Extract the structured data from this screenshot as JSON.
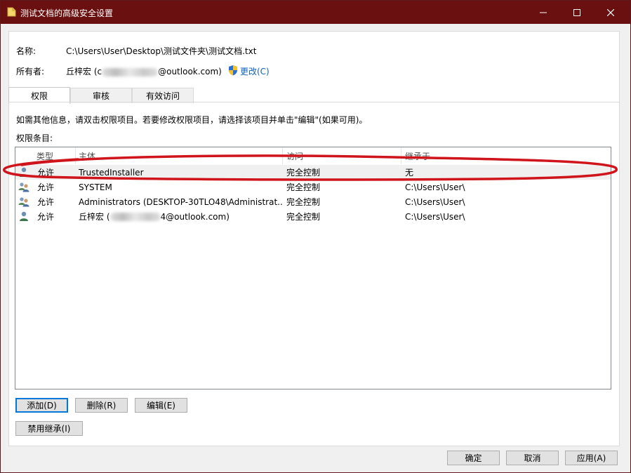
{
  "window": {
    "title": "测试文档的高级安全设置"
  },
  "info": {
    "name_label": "名称:",
    "name_value": "C:\\Users\\User\\Desktop\\测试文件夹\\测试文档.txt",
    "owner_label": "所有者:",
    "owner_name": "丘梓宏 (c",
    "owner_email_suffix": "@outlook.com)",
    "change_link": "更改(C)"
  },
  "tabs": [
    {
      "label": "权限"
    },
    {
      "label": "审核"
    },
    {
      "label": "有效访问"
    }
  ],
  "hint": "如需其他信息，请双击权限项目。若要修改权限项目，请选择该项目并单击\"编辑\"(如果可用)。",
  "entries_label": "权限条目:",
  "columns": {
    "type": "类型",
    "principal": "主体",
    "access": "访问",
    "inherited": "继承于"
  },
  "entries": [
    {
      "type": "允许",
      "principal": "TrustedInstaller",
      "access": "完全控制",
      "inherited": "无",
      "icon": "user-icon"
    },
    {
      "type": "允许",
      "principal": "SYSTEM",
      "access": "完全控制",
      "inherited": "C:\\Users\\User\\",
      "icon": "group-icon"
    },
    {
      "type": "允许",
      "principal": "Administrators (DESKTOP-30TLO48\\Administrat...",
      "access": "完全控制",
      "inherited": "C:\\Users\\User\\",
      "icon": "group-icon"
    },
    {
      "type": "允许",
      "principal": "丘梓宏 (",
      "principal_suffix": "4@outlook.com)",
      "access": "完全控制",
      "inherited": "C:\\Users\\User\\",
      "icon": "user-icon"
    }
  ],
  "buttons": {
    "add": "添加(D)",
    "remove": "删除(R)",
    "edit": "编辑(E)",
    "disable_inheritance": "禁用继承(I)",
    "ok": "确定",
    "cancel": "取消",
    "apply": "应用(A)"
  },
  "colors": {
    "titlebar": "#6b1010",
    "link": "#0b62c4",
    "annotation": "#d0141c"
  }
}
